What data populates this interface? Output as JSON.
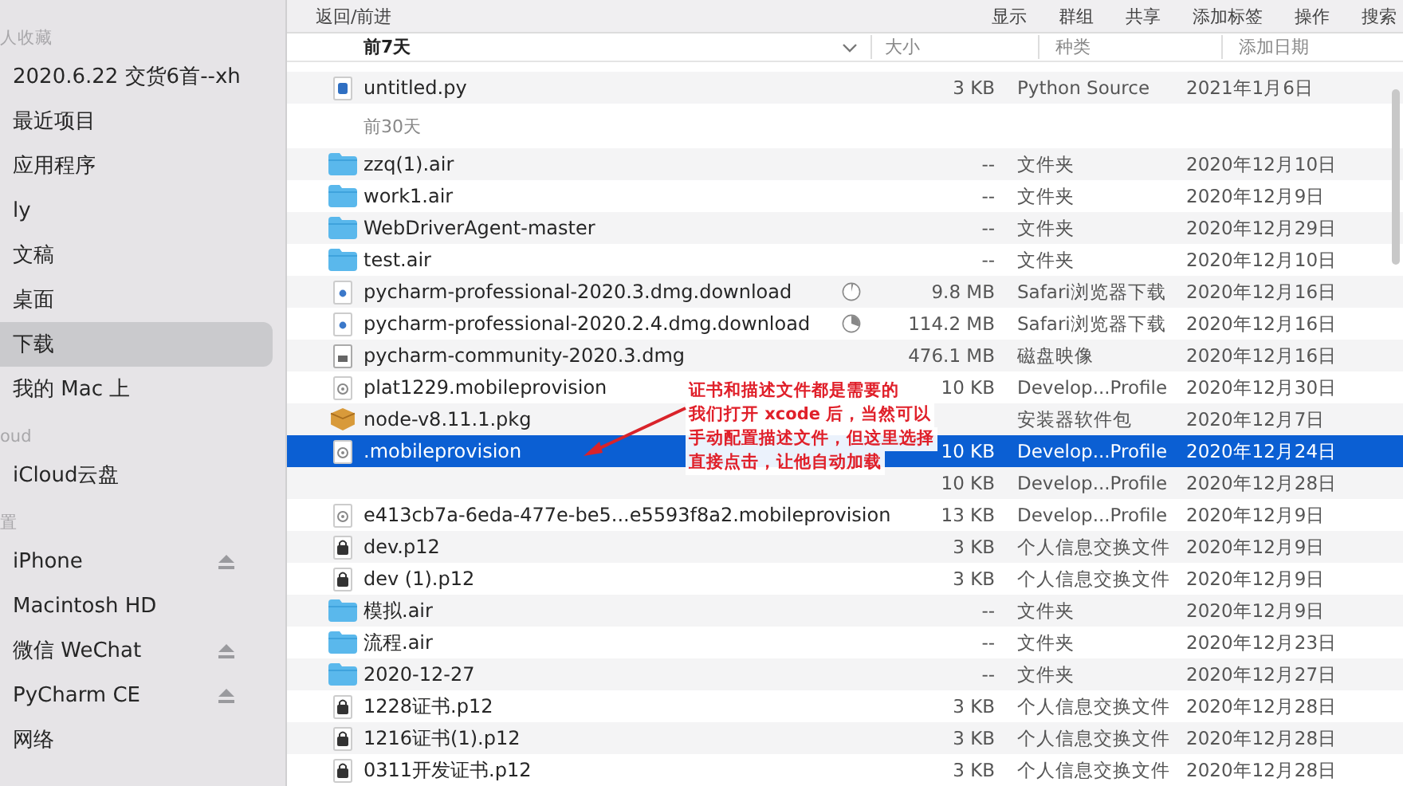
{
  "toolbar": {
    "nav": "返回/前进",
    "buttons": [
      "显示",
      "群组",
      "共享",
      "添加标签",
      "操作",
      "搜索"
    ]
  },
  "sidebar": {
    "sections": [
      {
        "header": "人收藏",
        "items": [
          {
            "label": "2020.6.22 交货6首--xh",
            "selected": false,
            "eject": false
          },
          {
            "label": "最近项目",
            "selected": false,
            "eject": false
          },
          {
            "label": "应用程序",
            "selected": false,
            "eject": false
          },
          {
            "label": "ly",
            "selected": false,
            "eject": false
          },
          {
            "label": "文稿",
            "selected": false,
            "eject": false
          },
          {
            "label": "桌面",
            "selected": false,
            "eject": false
          },
          {
            "label": "下载",
            "selected": true,
            "eject": false
          },
          {
            "label": "我的 Mac 上",
            "selected": false,
            "eject": false
          }
        ]
      },
      {
        "header": "oud",
        "items": [
          {
            "label": "iCloud云盘",
            "selected": false,
            "eject": false
          }
        ]
      },
      {
        "header": "置",
        "items": [
          {
            "label": "iPhone",
            "selected": false,
            "eject": true
          },
          {
            "label": "Macintosh HD",
            "selected": false,
            "eject": false
          },
          {
            "label": "微信 WeChat",
            "selected": false,
            "eject": true
          },
          {
            "label": "PyCharm CE",
            "selected": false,
            "eject": true
          },
          {
            "label": "网络",
            "selected": false,
            "eject": false
          }
        ]
      }
    ]
  },
  "columns": {
    "group": "前7天",
    "size": "大小",
    "kind": "种类",
    "date": "添加日期"
  },
  "list": [
    {
      "kind": "python",
      "name": "untitled.py",
      "size": "3 KB",
      "type": "Python Source",
      "date": "2021年1月6日",
      "selected": false
    },
    {
      "kind": "group",
      "label": "前30天"
    },
    {
      "kind": "folder",
      "name": "zzq(1).air",
      "size": "--",
      "type": "文件夹",
      "date": "2020年12月10日",
      "selected": false
    },
    {
      "kind": "folder",
      "name": "work1.air",
      "size": "--",
      "type": "文件夹",
      "date": "2020年12月9日",
      "selected": false
    },
    {
      "kind": "folder",
      "name": "WebDriverAgent-master",
      "size": "--",
      "type": "文件夹",
      "date": "2020年12月29日",
      "selected": false
    },
    {
      "kind": "folder",
      "name": "test.air",
      "size": "--",
      "type": "文件夹",
      "date": "2020年12月10日",
      "selected": false
    },
    {
      "kind": "download",
      "name": "pycharm-professional-2020.3.dmg.download",
      "size": "9.8 MB",
      "type": "Safari浏览器下载",
      "date": "2020年12月16日",
      "selected": false,
      "level": 0.04
    },
    {
      "kind": "download",
      "name": "pycharm-professional-2020.2.4.dmg.download",
      "size": "114.2 MB",
      "type": "Safari浏览器下载",
      "date": "2020年12月16日",
      "selected": false,
      "level": 0.3
    },
    {
      "kind": "diskimage",
      "name": "pycharm-community-2020.3.dmg",
      "size": "476.1 MB",
      "type": "磁盘映像",
      "date": "2020年12月16日",
      "selected": false
    },
    {
      "kind": "profile",
      "name": "plat1229.mobileprovision",
      "size": "10 KB",
      "type": "Develop...Profile",
      "date": "2020年12月30日",
      "selected": false
    },
    {
      "kind": "package",
      "name": "node-v8.11.1.pkg",
      "type": "安装器软件包",
      "date": "2020年12月7日",
      "selected": false
    },
    {
      "kind": "profile",
      "name": ".mobileprovision",
      "size": "10 KB",
      "type": "Develop...Profile",
      "date": "2020年12月24日",
      "selected": true
    },
    {
      "kind": "unnamed",
      "size": "10 KB",
      "type": "Develop...Profile",
      "date": "2020年12月28日",
      "selected": false
    },
    {
      "kind": "profile",
      "name": "e413cb7a-6eda-477e-be5...e5593f8a2.mobileprovision",
      "size": "13 KB",
      "type": "Develop...Profile",
      "date": "2020年12月9日",
      "selected": false
    },
    {
      "kind": "certificate",
      "name": "dev.p12",
      "size": "3 KB",
      "type": "个人信息交换文件",
      "date": "2020年12月9日",
      "selected": false
    },
    {
      "kind": "certificate",
      "name": "dev (1).p12",
      "size": "3 KB",
      "type": "个人信息交换文件",
      "date": "2020年12月9日",
      "selected": false
    },
    {
      "kind": "folder",
      "name": "模拟.air",
      "size": "--",
      "type": "文件夹",
      "date": "2020年12月9日",
      "selected": false
    },
    {
      "kind": "folder",
      "name": "流程.air",
      "size": "--",
      "type": "文件夹",
      "date": "2020年12月23日",
      "selected": false
    },
    {
      "kind": "folder",
      "name": "2020-12-27",
      "size": "--",
      "type": "文件夹",
      "date": "2020年12月27日",
      "selected": false
    },
    {
      "kind": "certificate",
      "name": "1228证书.p12",
      "size": "3 KB",
      "type": "个人信息交换文件",
      "date": "2020年12月28日",
      "selected": false
    },
    {
      "kind": "certificate",
      "name": "1216证书(1).p12",
      "size": "3 KB",
      "type": "个人信息交换文件",
      "date": "2020年12月28日",
      "selected": false
    },
    {
      "kind": "certificate",
      "name": "0311开发证书.p12",
      "size": "3 KB",
      "type": "个人信息交换文件",
      "date": "2020年12月28日",
      "selected": false
    }
  ],
  "annotation": {
    "lines": [
      "证书和描述文件都是需要的",
      "我们打开 xcode 后，当然可以",
      "手动配置描述文件，但这里选择",
      "直接点击，让他自动加载"
    ]
  }
}
